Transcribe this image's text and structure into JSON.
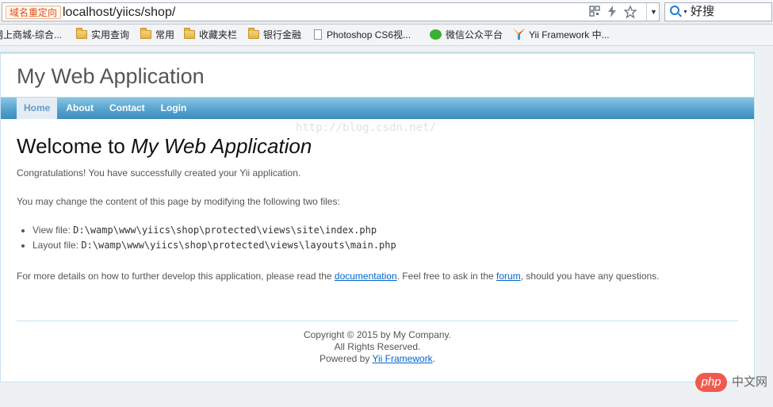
{
  "browser": {
    "redirect_badge": "域名重定向",
    "url": "localhost/yiics/shop/",
    "dropdown_arrow": "▼",
    "search_label": "好搜",
    "bookmarks": [
      {
        "label": "网上商城-综合...",
        "icon": "none"
      },
      {
        "label": "实用查询",
        "icon": "folder-icon"
      },
      {
        "label": "常用",
        "icon": "folder-icon"
      },
      {
        "label": "收藏夹栏",
        "icon": "folder-icon"
      },
      {
        "label": "银行金融",
        "icon": "folder-icon"
      },
      {
        "label": "Photoshop CS6视...",
        "icon": "page-icon"
      },
      {
        "label": "微信公众平台",
        "icon": "wechat-icon"
      },
      {
        "label": "Yii Framework 中...",
        "icon": "yii-icon"
      }
    ]
  },
  "site": {
    "title": "My Web Application",
    "menu": [
      {
        "label": "Home",
        "active": true
      },
      {
        "label": "About",
        "active": false
      },
      {
        "label": "Contact",
        "active": false
      },
      {
        "label": "Login",
        "active": false
      }
    ]
  },
  "content": {
    "welcome_prefix": "Welcome to ",
    "welcome_app": "My Web Application",
    "congrats": "Congratulations! You have successfully created your Yii application.",
    "change_intro": "You may change the content of this page by modifying the following two files:",
    "view_file_label": "View file: ",
    "view_file_path": "D:\\wamp\\www\\yiics\\shop\\protected\\views\\site\\index.php",
    "layout_file_label": "Layout file: ",
    "layout_file_path": "D:\\wamp\\www\\yiics\\shop\\protected\\views\\layouts\\main.php",
    "details_prefix": "For more details on how to further develop this application, please read the ",
    "documentation_link": "documentation",
    "details_mid": ". Feel free to ask in the ",
    "forum_link": "forum",
    "details_suffix": ", should you have any questions.",
    "watermark": "http://blog.csdn.net/"
  },
  "footer": {
    "copyright": "Copyright © 2015 by My Company.",
    "rights": "All Rights Reserved.",
    "powered_prefix": "Powered by ",
    "powered_link": "Yii Framework",
    "powered_suffix": "."
  },
  "corner_badge": {
    "logo": "php",
    "text": "中文网"
  }
}
